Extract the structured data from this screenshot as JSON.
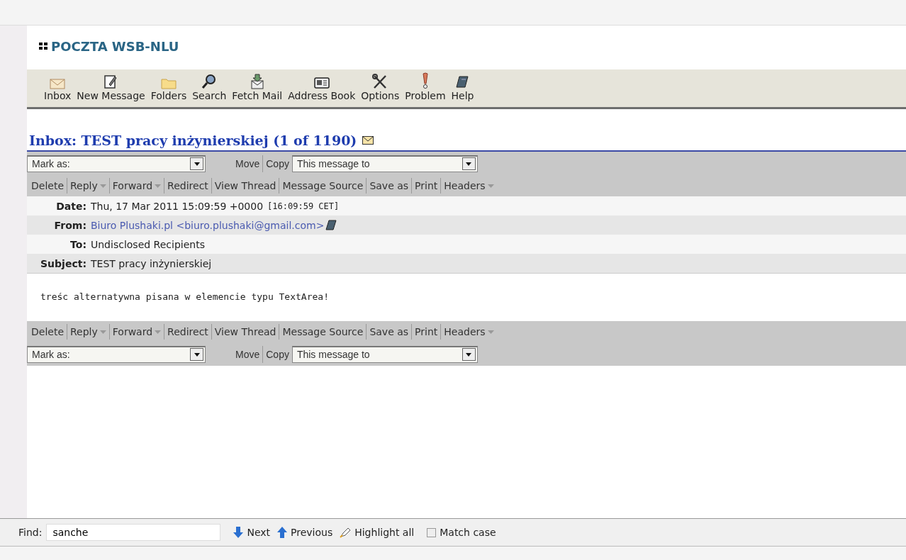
{
  "app_title": "POCZTA WSB-NLU",
  "toolbar": [
    {
      "label": "Inbox"
    },
    {
      "label": "New Message"
    },
    {
      "label": "Folders"
    },
    {
      "label": "Search"
    },
    {
      "label": "Fetch Mail"
    },
    {
      "label": "Address Book"
    },
    {
      "label": "Options"
    },
    {
      "label": "Problem"
    },
    {
      "label": "Help"
    }
  ],
  "message_heading": "Inbox: TEST pracy inżynierskiej (1 of 1190)",
  "top_controls": {
    "mark_as": "Mark as:",
    "move": "Move",
    "copy": "Copy",
    "target": "This message to"
  },
  "actions_top": [
    {
      "label": "Delete",
      "has_menu": false
    },
    {
      "label": "Reply",
      "has_menu": true
    },
    {
      "label": "Forward",
      "has_menu": true
    },
    {
      "label": "Redirect",
      "has_menu": false
    },
    {
      "label": "View Thread",
      "has_menu": false
    },
    {
      "label": "Message Source",
      "has_menu": false
    },
    {
      "label": "Save as",
      "has_menu": false
    },
    {
      "label": "Print",
      "has_menu": false
    },
    {
      "label": "Headers",
      "has_menu": true
    }
  ],
  "headers": [
    {
      "label": "Date:",
      "kind": "text",
      "value": "Thu, 17 Mar 2011 15:09:59 +0000",
      "note": "[16:09:59 CET]"
    },
    {
      "label": "From:",
      "kind": "link",
      "value": "Biuro Plushaki.pl <biuro.plushaki@gmail.com>"
    },
    {
      "label": "To:",
      "kind": "text",
      "value": "Undisclosed Recipients"
    },
    {
      "label": "Subject:",
      "kind": "text",
      "value": "TEST pracy inżynierskiej"
    }
  ],
  "body": "treśc alternatywna pisana w elemencie typu TextArea!",
  "actions_bottom": [
    {
      "label": "Delete",
      "has_menu": false
    },
    {
      "label": "Reply",
      "has_menu": true
    },
    {
      "label": "Forward",
      "has_menu": true
    },
    {
      "label": "Redirect",
      "has_menu": false
    },
    {
      "label": "View Thread",
      "has_menu": false
    },
    {
      "label": "Message Source",
      "has_menu": false
    },
    {
      "label": "Save as",
      "has_menu": false
    },
    {
      "label": "Print",
      "has_menu": false
    },
    {
      "label": "Headers",
      "has_menu": true
    }
  ],
  "bottom_controls": {
    "mark_as": "Mark as:",
    "move": "Move",
    "copy": "Copy",
    "target": "This message to"
  },
  "find_bar": {
    "label": "Find:",
    "value": "sanche",
    "next": "Next",
    "previous": "Previous",
    "highlight": "Highlight all",
    "match_case": {
      "label": "Match case",
      "checked": false
    }
  }
}
